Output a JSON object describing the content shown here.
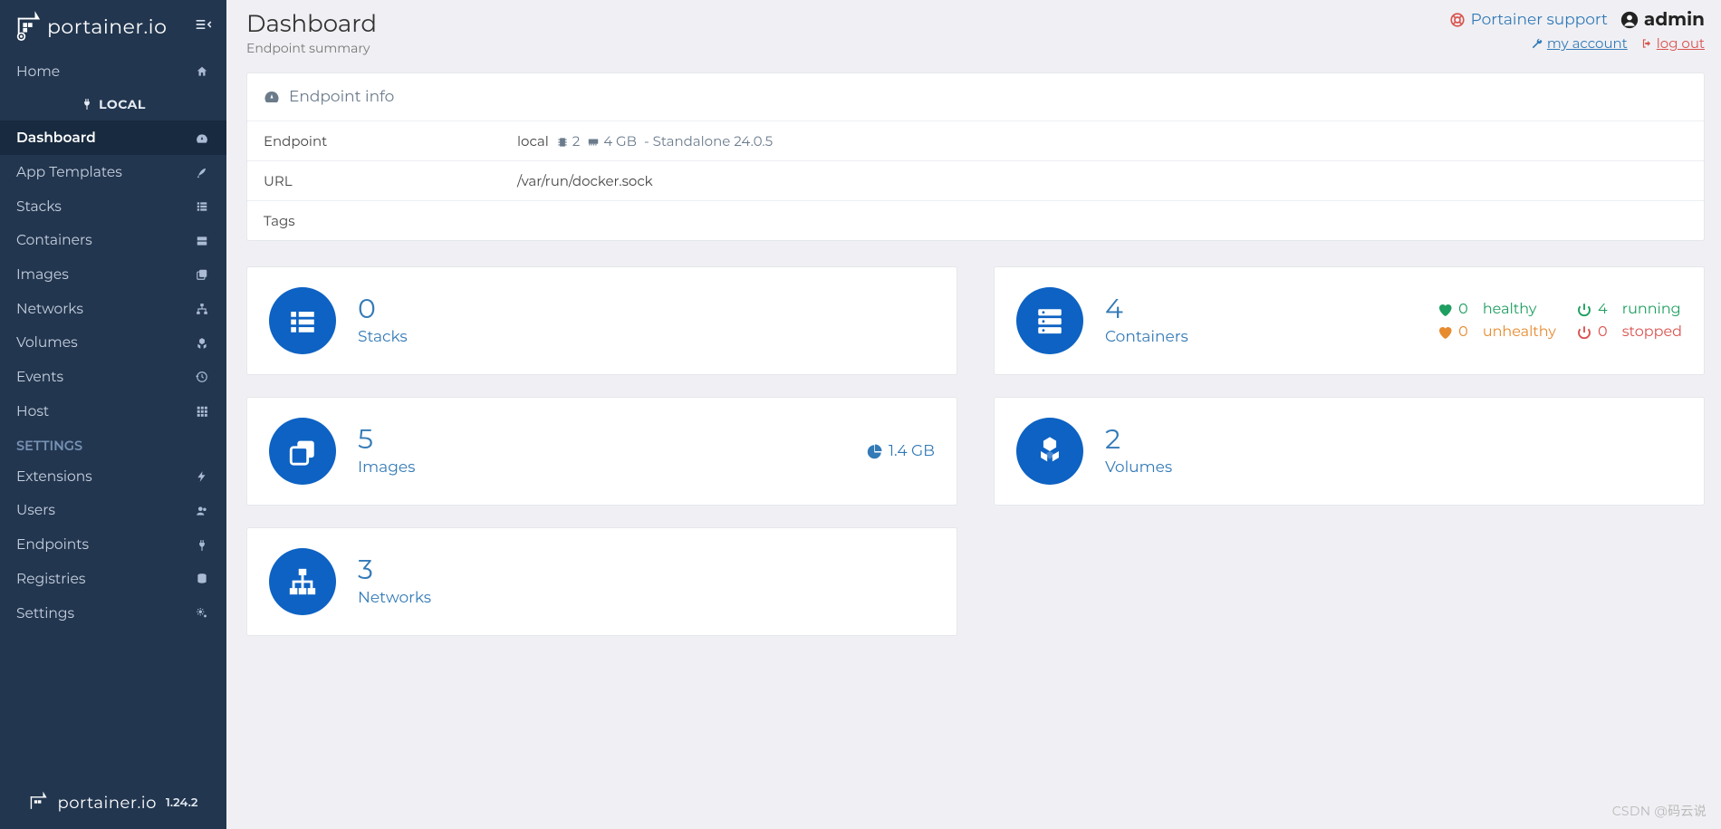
{
  "brand": "portainer.io",
  "version": "1.24.2",
  "page": {
    "title": "Dashboard",
    "subtitle": "Endpoint summary"
  },
  "header": {
    "support": "Portainer support",
    "user": "admin",
    "account": "my account",
    "logout": "log out"
  },
  "sidebar": {
    "home": "Home",
    "section": "LOCAL",
    "settings_header": "SETTINGS",
    "items": {
      "dashboard": "Dashboard",
      "app_templates": "App Templates",
      "stacks": "Stacks",
      "containers": "Containers",
      "images": "Images",
      "networks": "Networks",
      "volumes": "Volumes",
      "events": "Events",
      "host": "Host",
      "extensions": "Extensions",
      "users": "Users",
      "endpoints": "Endpoints",
      "registries": "Registries",
      "settings": "Settings"
    }
  },
  "endpoint_panel": {
    "title": "Endpoint info",
    "rows": {
      "endpoint": {
        "key": "Endpoint",
        "name": "local",
        "cpu": "2",
        "mem": "4 GB",
        "mode": "Standalone 24.0.5"
      },
      "url": {
        "key": "URL",
        "value": "/var/run/docker.sock"
      },
      "tags": {
        "key": "Tags",
        "value": ""
      }
    }
  },
  "tiles": {
    "stacks": {
      "count": "0",
      "label": "Stacks"
    },
    "containers": {
      "count": "4",
      "label": "Containers",
      "healthy_n": "0",
      "healthy_t": "healthy",
      "unhealthy_n": "0",
      "unhealthy_t": "unhealthy",
      "running_n": "4",
      "running_t": "running",
      "stopped_n": "0",
      "stopped_t": "stopped"
    },
    "images": {
      "count": "5",
      "label": "Images",
      "size": "1.4 GB"
    },
    "volumes": {
      "count": "2",
      "label": "Volumes"
    },
    "networks": {
      "count": "3",
      "label": "Networks"
    }
  },
  "watermark": "CSDN @码云说"
}
